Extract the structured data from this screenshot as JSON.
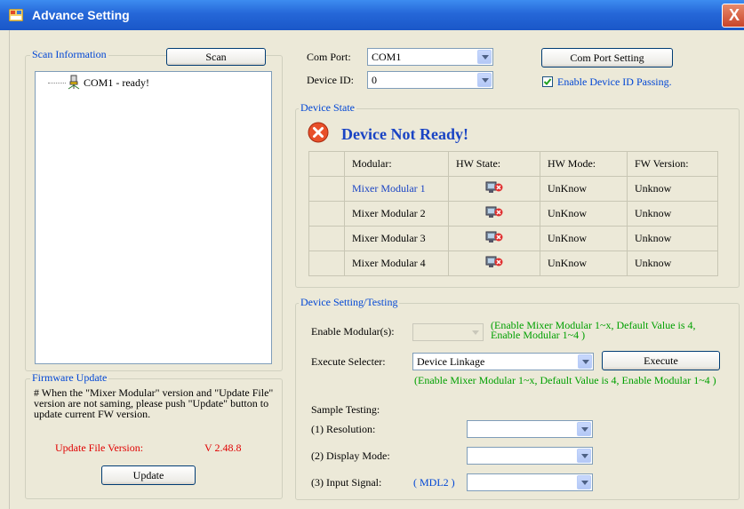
{
  "window": {
    "title": "Advance Setting",
    "close_label": "X"
  },
  "scan_info": {
    "group_label": "Scan Information",
    "scan_button": "Scan",
    "items": [
      "COM1 - ready!"
    ]
  },
  "com": {
    "port_label": "Com Port:",
    "port_value": "COM1",
    "device_id_label": "Device ID:",
    "device_id_value": "0",
    "setting_button": "Com Port Setting",
    "enable_id_label": "Enable Device ID Passing.",
    "enable_id_checked": true
  },
  "device_state": {
    "group_label": "Device State",
    "status_text": "Device Not Ready!",
    "headers": [
      "Modular:",
      "HW State:",
      "HW Mode:",
      "FW Version:"
    ],
    "rows": [
      {
        "modular": "Mixer Modular 1",
        "hw_mode": "UnKnow",
        "fw_version": "Unknow"
      },
      {
        "modular": "Mixer Modular 2",
        "hw_mode": "UnKnow",
        "fw_version": "Unknow"
      },
      {
        "modular": "Mixer Modular 3",
        "hw_mode": "UnKnow",
        "fw_version": "Unknow"
      },
      {
        "modular": "Mixer Modular 4",
        "hw_mode": "UnKnow",
        "fw_version": "Unknow"
      }
    ]
  },
  "firmware": {
    "group_label": "Firmware Update",
    "note": "# When the \"Mixer Modular\" version and \"Update File\" version are not saming, please push \"Update\" button to update current FW version.",
    "version_label": "Update File Version:",
    "version_value": "V 2.48.8",
    "update_button": "Update"
  },
  "testing": {
    "group_label": "Device Setting/Testing",
    "enable_label": "Enable Modular(s):",
    "enable_hint": "(Enable Mixer Modular 1~x, Default Value is 4, Enable Modular 1~4 )",
    "execute_label": "Execute Selecter:",
    "execute_value": "Device Linkage",
    "execute_button": "Execute",
    "execute_hint": "(Enable Mixer Modular 1~x, Default Value is 4, Enable Modular 1~4 )",
    "sample_label": "Sample Testing:",
    "resolution_label": "(1) Resolution:",
    "display_label": "(2) Display Mode:",
    "input_label": "(3) Input Signal:",
    "input_tag": "( MDL2 )"
  },
  "colors": {
    "title_bar": "#2567d8",
    "group_label": "#0046d5",
    "hint": "#00a000",
    "version": "#e00000"
  }
}
